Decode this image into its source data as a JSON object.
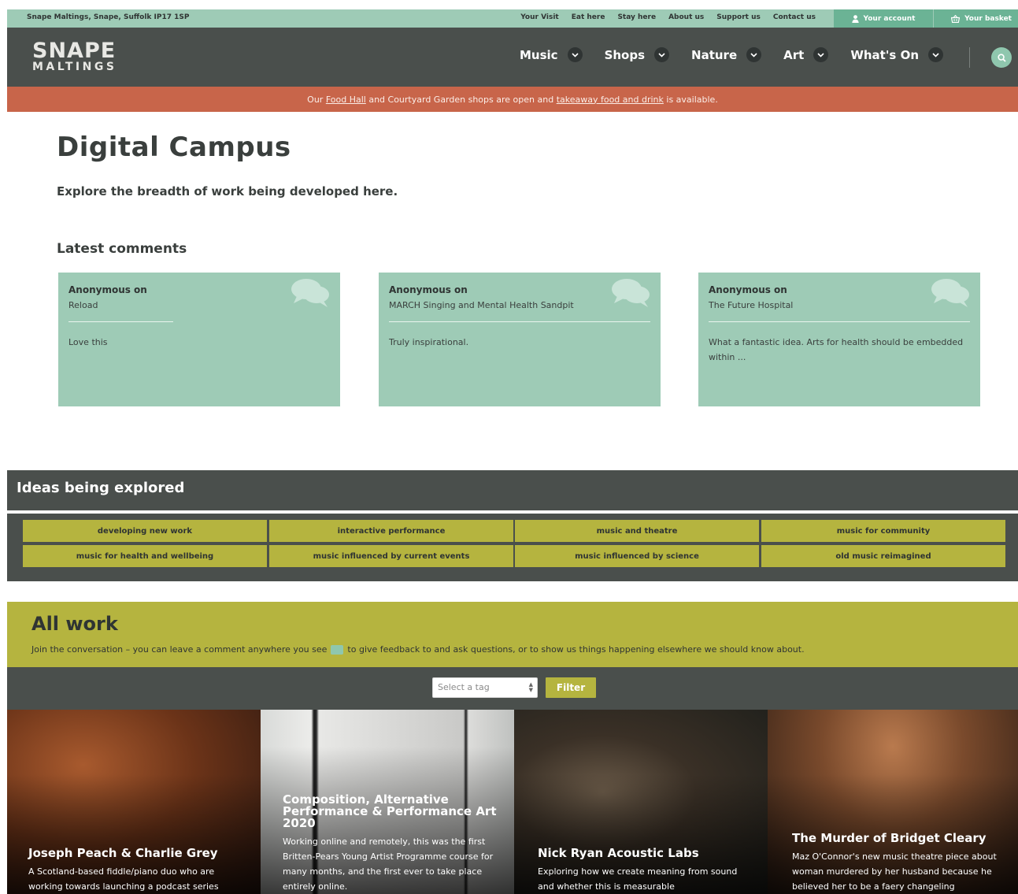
{
  "utility": {
    "address": "Snape Maltings, Snape, Suffolk IP17 1SP",
    "links": [
      "Your Visit",
      "Eat here",
      "Stay here",
      "About us",
      "Support us",
      "Contact us"
    ],
    "account": "Your account",
    "basket": "Your basket"
  },
  "header": {
    "logo_line1": "SNAPE",
    "logo_line2": "MALTINGS",
    "nav": [
      "Music",
      "Shops",
      "Nature",
      "Art",
      "What's On"
    ]
  },
  "alert": {
    "prefix": "Our ",
    "link1": "Food Hall",
    "middle": " and Courtyard Garden shops are open and ",
    "link2": "takeaway food and drink",
    "suffix": " is available."
  },
  "page": {
    "title": "Digital Campus",
    "subtitle": "Explore the breadth of work being developed here."
  },
  "comments": {
    "heading": "Latest comments",
    "items": [
      {
        "author": "Anonymous on",
        "on": "Reload",
        "text": "Love this"
      },
      {
        "author": "Anonymous on",
        "on": "MARCH Singing and Mental Health Sandpit",
        "text": "Truly inspirational."
      },
      {
        "author": "Anonymous on",
        "on": "The Future Hospital",
        "text": "What a fantastic idea. Arts for health should be embedded within ..."
      }
    ]
  },
  "ideas": {
    "heading": "Ideas being explored",
    "tags": [
      "developing new work",
      "interactive performance",
      "music and theatre",
      "music for community",
      "music for health and wellbeing",
      "music influenced by current events",
      "music influenced by science",
      "old music reimagined"
    ]
  },
  "allwork": {
    "title": "All work",
    "note_before": "Join the conversation – you can leave a comment anywhere you see",
    "note_after": "to give feedback to and ask questions, or to show us things happening elsewhere we should know about.",
    "select_placeholder": "Select a tag",
    "filter_label": "Filter",
    "items": [
      {
        "title": "Joseph Peach & Charlie Grey",
        "desc": "A Scotland-based fiddle/piano duo who are working towards launching a podcast series"
      },
      {
        "title": "Composition, Alternative Performance & Performance Art 2020",
        "desc": "Working online and remotely, this was the first Britten-Pears Young Artist Programme course for many months, and the first ever to take place entirely online."
      },
      {
        "title": "Nick Ryan Acoustic Labs",
        "desc": "Exploring how we create meaning from sound and whether this is measurable"
      },
      {
        "title": "The Murder of Bridget Cleary",
        "desc": "Maz O'Connor's new music theatre piece about woman murdered by her husband because he believed her to be a faery changeling"
      }
    ]
  },
  "colors": {
    "mint": "#9ecbb6",
    "charcoal": "#4a4f4c",
    "alert": "#c8654a",
    "olive": "#b5b43f"
  },
  "icons": [
    "user-icon",
    "basket-icon",
    "chevron-down-icon",
    "search-icon",
    "speech-bubbles-icon"
  ]
}
